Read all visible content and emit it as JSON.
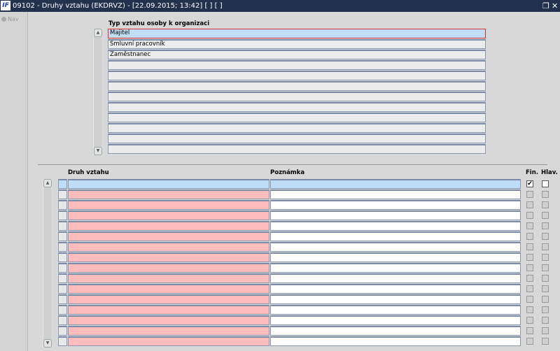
{
  "window": {
    "logo": "IF",
    "title": "09102 - Druhy vztahu (EKDRVZ) - [22.09.2015; 13:42]  [ ]  [ ]",
    "restore_icon": "restore-icon",
    "close_icon": "close-icon",
    "restore": "❐",
    "close": "✕"
  },
  "sidebar": {
    "nav_label": "Nav"
  },
  "top_block": {
    "header": "Typ vztahu osoby k organizaci",
    "rows": [
      "Majitel",
      "Smluvní pracovník",
      "Zaměstnanec",
      "",
      "",
      "",
      "",
      "",
      "",
      "",
      "",
      ""
    ]
  },
  "bottom_block": {
    "headers": {
      "druh": "Druh vztahu",
      "poznamka": "Poznámka",
      "fin": "Fin.",
      "hlav": "Hlav."
    },
    "rows": [
      {
        "druh": "",
        "poznamka": "",
        "fin": true,
        "hlav": false
      }
    ],
    "row_count": 16
  },
  "colors": {
    "titlebar": "#22324d",
    "selected": "#c0ddf8",
    "required": "#ffbcbc",
    "current_border": "#e03030"
  }
}
